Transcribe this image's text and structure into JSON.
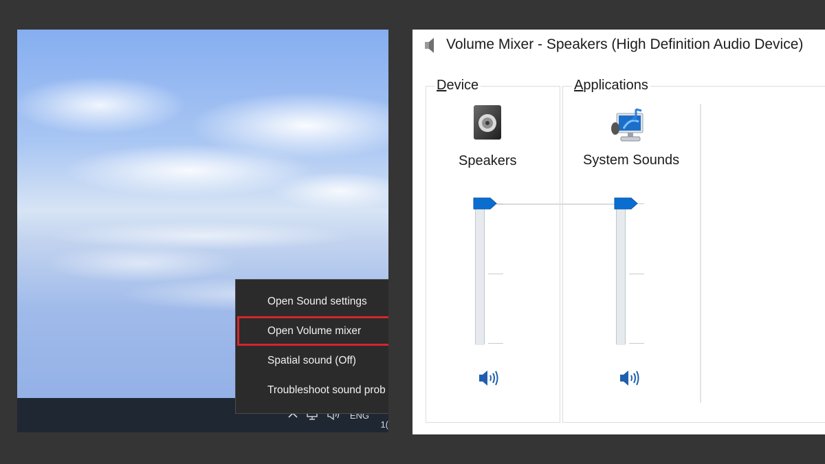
{
  "desktop": {
    "context_menu": {
      "items": [
        {
          "label": "Open Sound settings"
        },
        {
          "label": "Open Volume mixer",
          "highlighted": true
        },
        {
          "label": "Spatial sound (Off)"
        },
        {
          "label": "Troubleshoot sound prob"
        }
      ]
    },
    "taskbar": {
      "language": "ENG",
      "clock_partial": "1(",
      "icons": [
        "chevron-up-icon",
        "network-icon",
        "volume-icon"
      ]
    }
  },
  "mixer": {
    "title": "Volume Mixer - Speakers (High Definition Audio Device)",
    "device_group": {
      "label_prefix": "D",
      "label_rest": "evice",
      "channel": {
        "name": "Speakers",
        "icon": "speaker-box-icon",
        "volume_percent": 100
      }
    },
    "applications_group": {
      "label_prefix": "A",
      "label_rest": "pplications",
      "channels": [
        {
          "name": "System Sounds",
          "icon": "system-sounds-icon",
          "volume_percent": 100
        }
      ]
    },
    "colors": {
      "thumb": "#0a6ed1",
      "accent_red": "#d3262c"
    }
  }
}
